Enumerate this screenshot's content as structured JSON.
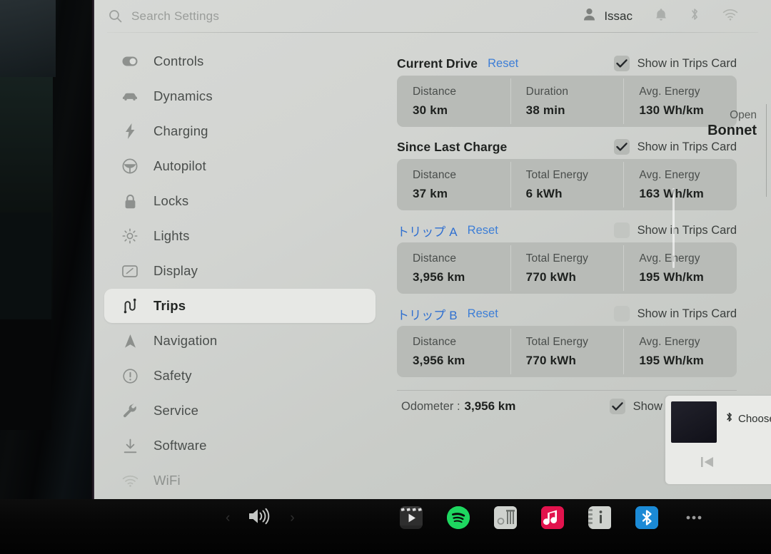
{
  "header": {
    "search_placeholder": "Search Settings",
    "user_name": "Issac",
    "icons": [
      "search-icon",
      "person-icon",
      "bell-icon",
      "bluetooth-icon",
      "wifi-icon"
    ]
  },
  "sidebar": {
    "items": [
      {
        "label": "Controls",
        "icon": "toggle-switch-icon",
        "selected": false
      },
      {
        "label": "Dynamics",
        "icon": "car-icon",
        "selected": false
      },
      {
        "label": "Charging",
        "icon": "lightning-bolt-icon",
        "selected": false
      },
      {
        "label": "Autopilot",
        "icon": "steering-wheel-icon",
        "selected": false
      },
      {
        "label": "Locks",
        "icon": "padlock-icon",
        "selected": false
      },
      {
        "label": "Lights",
        "icon": "light-bulb-icon",
        "selected": false
      },
      {
        "label": "Display",
        "icon": "display-icon",
        "selected": false
      },
      {
        "label": "Trips",
        "icon": "winding-road-icon",
        "selected": true
      },
      {
        "label": "Navigation",
        "icon": "navigation-arrow-icon",
        "selected": false
      },
      {
        "label": "Safety",
        "icon": "alert-circle-icon",
        "selected": false
      },
      {
        "label": "Service",
        "icon": "wrench-icon",
        "selected": false
      },
      {
        "label": "Software",
        "icon": "download-icon",
        "selected": false
      },
      {
        "label": "WiFi",
        "icon": "wifi-icon",
        "selected": false
      }
    ]
  },
  "trips": {
    "show_in_trips_card_label": "Show in Trips Card",
    "reset_label": "Reset",
    "sections": [
      {
        "title": "Current Drive",
        "has_reset": true,
        "checked": true,
        "cells": [
          {
            "label": "Distance",
            "value": "30 km"
          },
          {
            "label": "Duration",
            "value": "38 min"
          },
          {
            "label": "Avg. Energy",
            "value": "130 Wh/km"
          }
        ]
      },
      {
        "title": "Since Last Charge",
        "has_reset": false,
        "checked": true,
        "cells": [
          {
            "label": "Distance",
            "value": "37 km"
          },
          {
            "label": "Total Energy",
            "value": "6 kWh"
          },
          {
            "label": "Avg. Energy",
            "value": "163 Wh/km"
          }
        ]
      },
      {
        "title": "トリップ A",
        "has_reset": true,
        "checked": false,
        "cells": [
          {
            "label": "Distance",
            "value": "3,956 km"
          },
          {
            "label": "Total Energy",
            "value": "770 kWh"
          },
          {
            "label": "Avg. Energy",
            "value": "195 Wh/km"
          }
        ]
      },
      {
        "title": "トリップ B",
        "has_reset": true,
        "checked": false,
        "cells": [
          {
            "label": "Distance",
            "value": "3,956 km"
          },
          {
            "label": "Total Energy",
            "value": "770 kWh"
          },
          {
            "label": "Avg. Energy",
            "value": "195 Wh/km"
          }
        ]
      }
    ],
    "odometer": {
      "label": "Odometer :",
      "value": "3,956 km",
      "checked": true,
      "check_label": "Show in Trips Card"
    }
  },
  "right_panel": {
    "bonnet_action": "Open",
    "bonnet_target": "Bonnet",
    "media": {
      "bluetooth_text": "Choose",
      "prev_icon": "previous-track-icon",
      "bt_icon": "bluetooth-icon"
    }
  },
  "dock": {
    "left_chevron": "‹",
    "right_chevron": "›",
    "volume_icon": "speaker-volume-icon",
    "apps": [
      {
        "name": "video-app-icon",
        "class": "app-video"
      },
      {
        "name": "spotify-app-icon",
        "class": "app-spotify"
      },
      {
        "name": "radio-app-icon",
        "class": "app-radio"
      },
      {
        "name": "music-app-icon",
        "class": "app-music"
      },
      {
        "name": "manual-info-app-icon",
        "class": "app-manual"
      },
      {
        "name": "bluetooth-app-icon",
        "class": "app-bt"
      },
      {
        "name": "more-options-icon",
        "class": "app-more"
      }
    ]
  },
  "colors": {
    "accent_link": "#3d7ed6",
    "screen_bg": "#d2d4d1",
    "card_bg": "#b8bbb7",
    "selected_item_bg": "#e7e8e5",
    "dock_bg": "#060606",
    "spotify_green": "#1ed760"
  }
}
